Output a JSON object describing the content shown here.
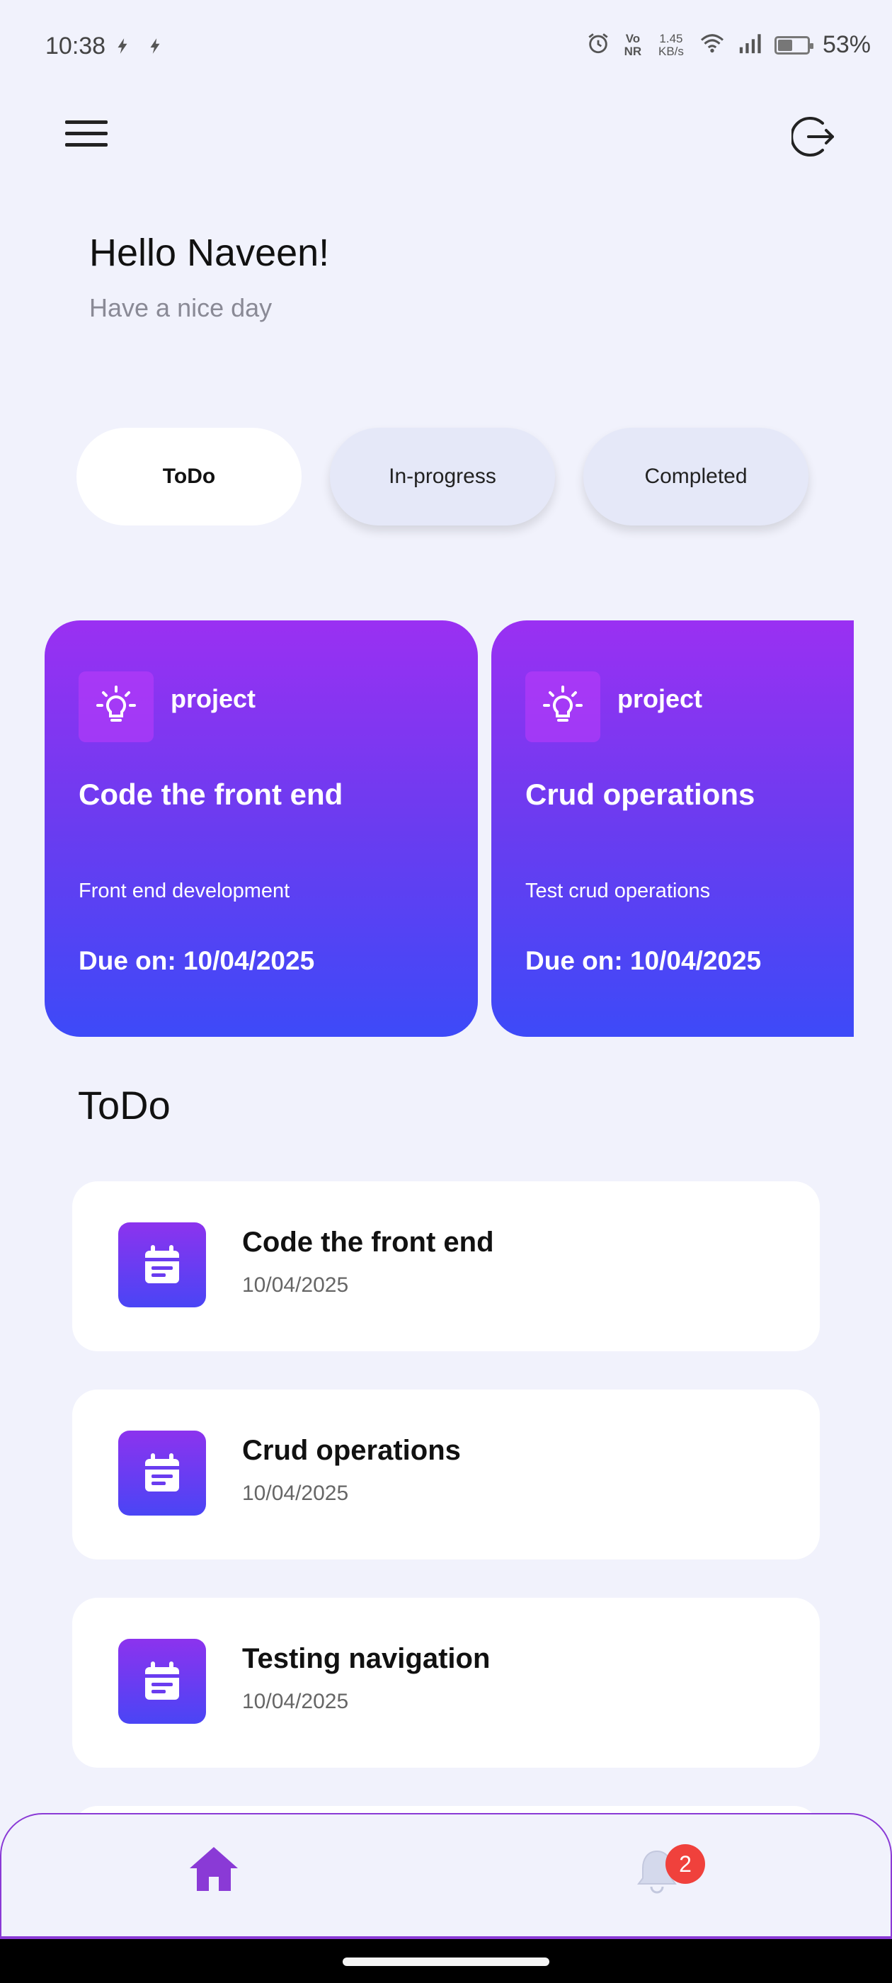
{
  "status": {
    "time": "10:38",
    "network_type": "Vo NR",
    "speed": "1.45 KB/s",
    "battery_percent": "53%",
    "battery_level": 0.53
  },
  "header": {
    "greeting": "Hello Naveen!",
    "subgreeting": "Have a nice day"
  },
  "tabs": [
    {
      "label": "ToDo",
      "active": true
    },
    {
      "label": "In-progress",
      "active": false
    },
    {
      "label": "Completed",
      "active": false
    }
  ],
  "project_cards": [
    {
      "tag": "project",
      "title": "Code the front end",
      "description": "Front end development",
      "due": "Due on: 10/04/2025"
    },
    {
      "tag": "project",
      "title": "Crud operations",
      "description": "Test crud operations",
      "due": "Due on: 10/04/2025"
    }
  ],
  "section_title": "ToDo",
  "tasks": [
    {
      "title": "Code the front end",
      "date": "10/04/2025"
    },
    {
      "title": "Crud operations",
      "date": "10/04/2025"
    },
    {
      "title": "Testing navigation",
      "date": "10/04/2025"
    }
  ],
  "bottom_nav": {
    "notification_count": "2"
  },
  "colors": {
    "accent": "#8a3ad6",
    "card_gradient_top": "#9a30f2",
    "card_gradient_bottom": "#3d4af8",
    "badge": "#f0413c",
    "background": "#f1f2fc"
  }
}
